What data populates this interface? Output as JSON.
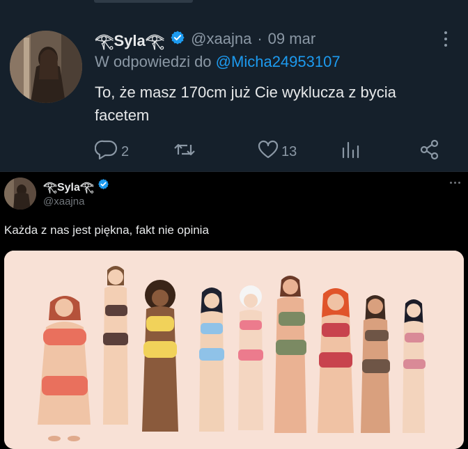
{
  "tweet": {
    "display_name": "𓂀Syla𓂀",
    "handle": "@xaajna",
    "separator": "·",
    "date": "09 mar",
    "reply_prefix": "W odpowiedzi do",
    "reply_to": "@Micha24953107",
    "text": "To, że masz 170cm już Cie wyklucza z bycia facetem",
    "replies": "2",
    "likes": "13"
  },
  "quoted": {
    "display_name": "𓂀Syla𓂀",
    "handle": "@xaajna",
    "text": "Każda z nas jest piękna, fakt nie opinia"
  },
  "icons": {
    "verified": "verified-badge-icon",
    "reply": "reply-icon",
    "retweet": "retweet-icon",
    "like": "heart-icon",
    "views": "views-icon",
    "share": "share-icon",
    "more": "more-icon"
  },
  "colors": {
    "dim_background": "#15202b",
    "black_background": "#000000",
    "accent": "#1d9bf0",
    "secondary_text": "#8b98a5",
    "primary_text": "#e7e9ea",
    "illustration_background": "#f8e1d6"
  }
}
